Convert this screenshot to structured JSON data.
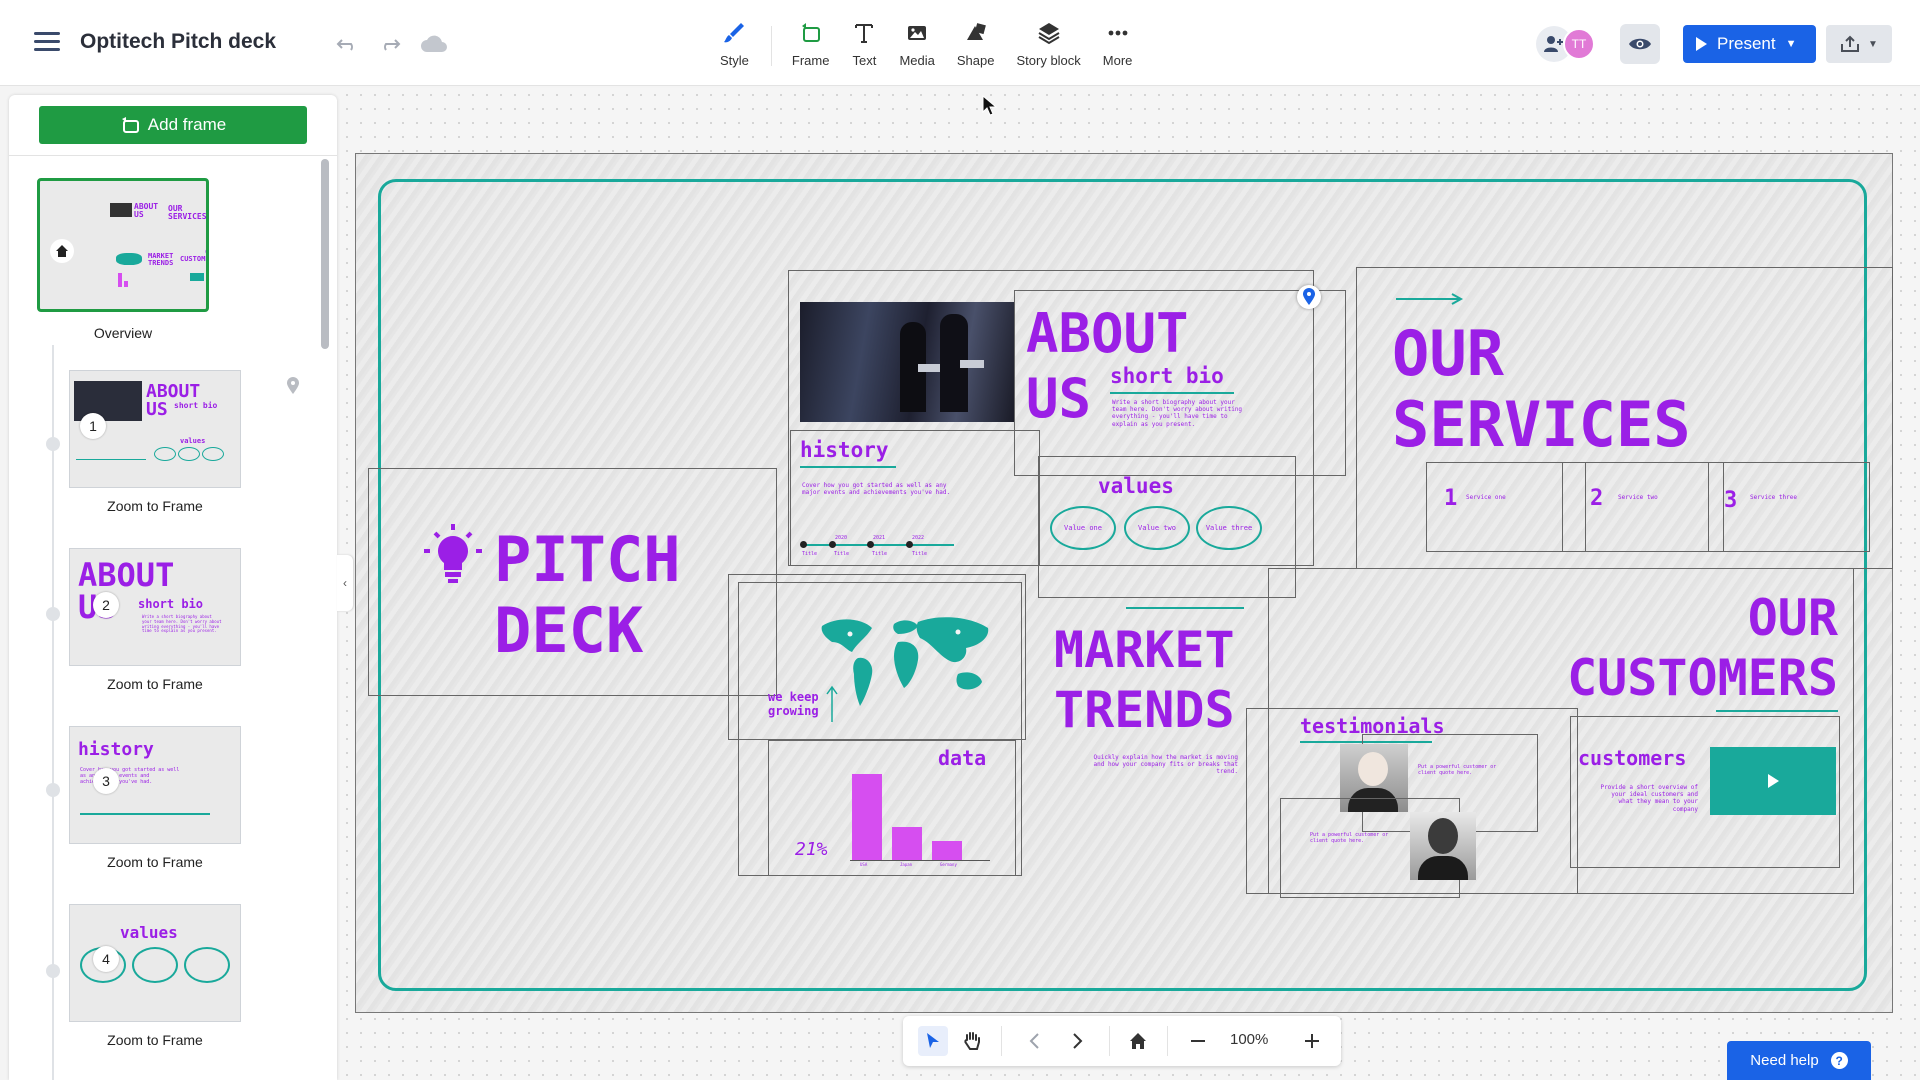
{
  "header": {
    "title": "Optitech Pitch deck",
    "tools": [
      {
        "label": "Style",
        "icon": "brush-icon"
      },
      {
        "label": "Frame",
        "icon": "frame-icon"
      },
      {
        "label": "Text",
        "icon": "text-icon"
      },
      {
        "label": "Media",
        "icon": "image-icon"
      },
      {
        "label": "Shape",
        "icon": "shape-icon"
      },
      {
        "label": "Story block",
        "icon": "layers-icon"
      },
      {
        "label": "More",
        "icon": "more-icon"
      }
    ],
    "avatar_initials": "TT",
    "present_label": "Present"
  },
  "panel": {
    "add_frame_label": "Add frame",
    "overview_label": "Overview",
    "frames": [
      {
        "number": "1",
        "caption": "Zoom to Frame"
      },
      {
        "number": "2",
        "caption": "Zoom to Frame"
      },
      {
        "number": "3",
        "caption": "Zoom to Frame"
      },
      {
        "number": "4",
        "caption": "Zoom to Frame"
      }
    ]
  },
  "slide": {
    "pitch_deck": "PITCH\nDECK",
    "about_title": "ABOUT\nUS",
    "about_sub": "short bio",
    "about_body": "Write a short biography about your team here. Don't worry about writing everything - you'll have time to explain as you present.",
    "history_title": "history",
    "history_body": "Cover how you got started as well as any major events and achievements you've had.",
    "timeline": [
      "Title",
      "Title",
      "Title",
      "Title"
    ],
    "timeline_years": [
      "2020",
      "2021",
      "2022"
    ],
    "values_title": "values",
    "values": [
      "Value one",
      "Value two",
      "Value three"
    ],
    "services_title": "OUR\nSERVICES",
    "services": [
      {
        "num": "1",
        "label": "Service one"
      },
      {
        "num": "2",
        "label": "Service two"
      },
      {
        "num": "3",
        "label": "Service three"
      }
    ],
    "we_keep": "we keep\ngrowing",
    "market_title": "MARKET\nTRENDS",
    "market_body": "Quickly explain how the market is moving and how your company fits or breaks that trend.",
    "data_title": "data",
    "data_pct": "21%",
    "data_categories": [
      "USA",
      "Japan",
      "Germany"
    ],
    "data_values": [
      100,
      38,
      22
    ],
    "testimonials_title": "testimonials",
    "testimonial_quote": "Put a powerful customer or client quote here.",
    "customers_title": "OUR\nCUSTOMERS",
    "customers_sub": "customers",
    "customers_body": "Provide a short overview of your ideal customers and what they mean to your company"
  },
  "bottombar": {
    "zoom": "100%"
  },
  "help": {
    "label": "Need help",
    "icon": "?"
  },
  "colors": {
    "accent_purple": "#9b1fe6",
    "accent_teal": "#19a99b",
    "present_blue": "#1a63e6",
    "add_frame_green": "#1f9b43"
  }
}
